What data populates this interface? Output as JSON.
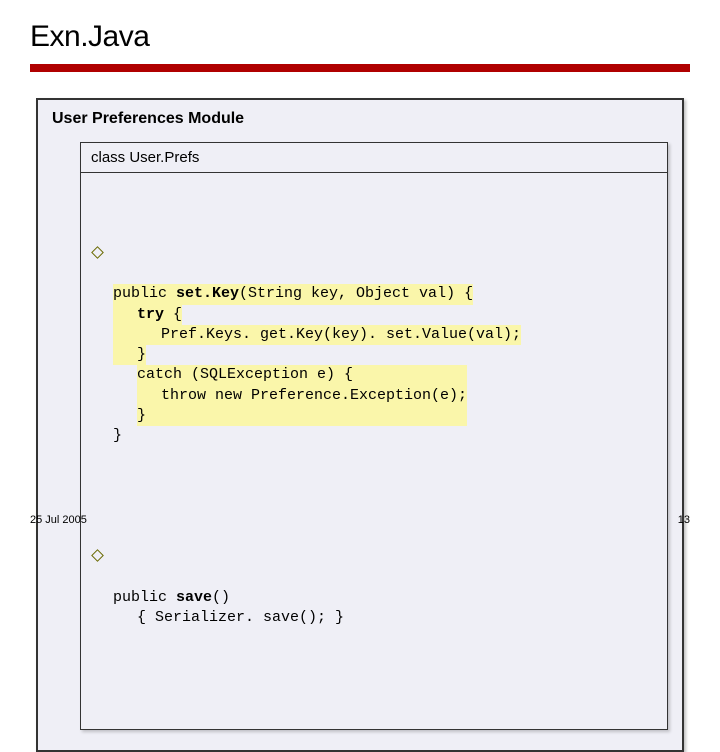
{
  "title": "Exn.Java",
  "module_title": "User Preferences Module",
  "class_label_prefix": "class ",
  "class_name": "User.Prefs",
  "method1": {
    "kw_public": "public",
    "sig_name": " set.Key",
    "sig_params": "(String key, Object val) {",
    "kw_try": "try",
    "try_open": " {",
    "try_body": "Pref.Keys. get.Key(key). set.Value(val);",
    "try_close": "}",
    "catch_line": "catch (SQLException e) {",
    "catch_body": "throw new Preference.Exception(e);",
    "catch_close": "}",
    "method_close": "}"
  },
  "method2": {
    "kw_public": "public",
    "sig_name": " save",
    "sig_rest": "()",
    "body": "{ Serializer. save(); }"
  },
  "footer_date": "25 Jul 2005",
  "footer_page": "13"
}
